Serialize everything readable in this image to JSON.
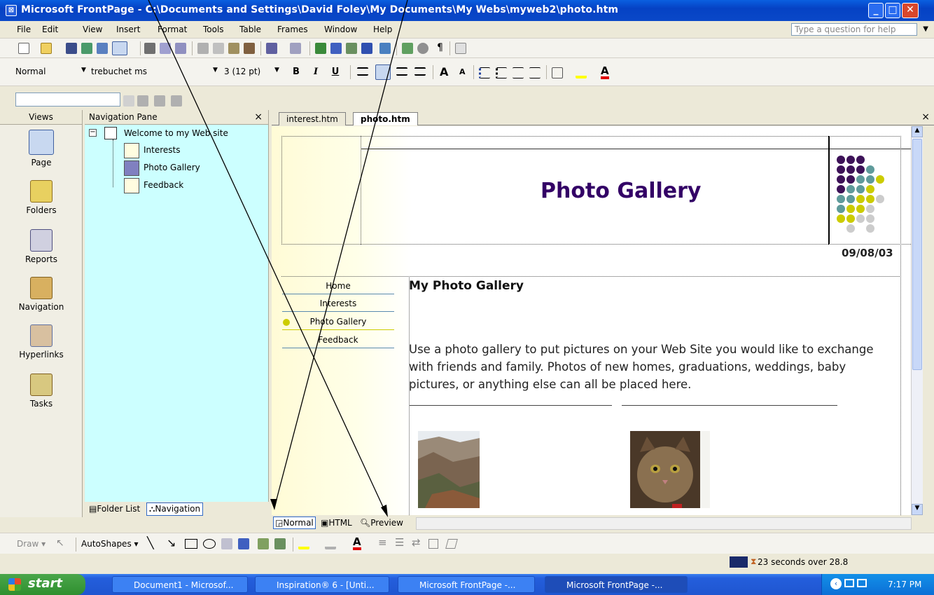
{
  "window": {
    "title": "Microsoft FrontPage - C:\\Documents and Settings\\David Foley\\My Documents\\My Webs\\myweb2\\photo.htm",
    "app_icon": "frontpage-icon"
  },
  "menu": {
    "items": [
      "File",
      "Edit",
      "View",
      "Insert",
      "Format",
      "Tools",
      "Table",
      "Frames",
      "Window",
      "Help"
    ],
    "help_placeholder": "Type a question for help"
  },
  "formatting": {
    "style": "Normal",
    "font": "trebuchet ms",
    "size": "3 (12 pt)",
    "bold": "B",
    "italic": "I",
    "underline": "U"
  },
  "views": {
    "header": "Views",
    "items": [
      "Page",
      "Folders",
      "Reports",
      "Navigation",
      "Hyperlinks",
      "Tasks"
    ],
    "selected": "Page"
  },
  "navpane": {
    "header": "Navigation Pane",
    "close": "×",
    "root": "Welcome to my Web site",
    "children": [
      "Interests",
      "Photo Gallery",
      "Feedback"
    ],
    "expander": "−",
    "folder_list_tab": "Folder List",
    "navigation_tab": "Navigation"
  },
  "doc": {
    "tabs": [
      "interest.htm",
      "photo.htm"
    ],
    "active_tab": "photo.htm",
    "close": "×",
    "view_tabs": [
      "Normal",
      "HTML",
      "Preview"
    ],
    "active_view": "Normal"
  },
  "webpage": {
    "banner_title": "Photo Gallery",
    "date": "09/08/03",
    "nav_links": [
      "Home",
      "Interests",
      "Photo Gallery",
      "Feedback"
    ],
    "current_link": "Photo Gallery",
    "heading": "My Photo Gallery",
    "body_text": "Use a photo gallery to put pictures on your Web Site you would like to exchange with friends and family. Photos of new homes, graduations, weddings, baby pictures, or anything else can all be placed here.",
    "colors": {
      "title": "#330066",
      "dark_dot": "#3d1258",
      "teal_dot": "#5f9b9b",
      "yellow_dot": "#cccc00",
      "gray_dot": "#cccccc"
    }
  },
  "drawbar": {
    "draw": "Draw ▾",
    "autoshapes": "AutoShapes ▾"
  },
  "status": {
    "text": "23 seconds over 28.8"
  },
  "taskbar": {
    "start": "start",
    "tasks": [
      "Document1 - Microsof...",
      "Inspiration® 6 - [Unti...",
      "Microsoft FrontPage -...",
      "Microsoft FrontPage -..."
    ],
    "active_task": 3,
    "clock": "7:17 PM"
  }
}
